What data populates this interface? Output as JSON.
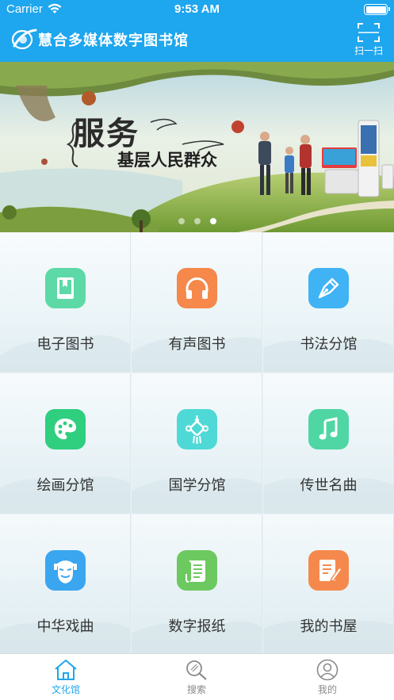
{
  "status_bar": {
    "carrier": "Carrier",
    "time": "9:53 AM"
  },
  "header": {
    "title": "慧合多媒体数字图书馆",
    "scan_label": "扫一扫"
  },
  "banner": {
    "headline": "服务",
    "subheadline": "基层人民群众",
    "dots": 3,
    "active_dot": 3
  },
  "grid": {
    "items": [
      {
        "label": "电子图书",
        "icon": "book-icon",
        "color": "#5cd9a6"
      },
      {
        "label": "有声图书",
        "icon": "headphones-icon",
        "color": "#f5884a"
      },
      {
        "label": "书法分馆",
        "icon": "pen-nib-icon",
        "color": "#3fb3f3"
      },
      {
        "label": "绘画分馆",
        "icon": "palette-icon",
        "color": "#2fcf7f"
      },
      {
        "label": "国学分馆",
        "icon": "chinese-knot-icon",
        "color": "#4fd9d6"
      },
      {
        "label": "传世名曲",
        "icon": "music-note-icon",
        "color": "#4fd6a4"
      },
      {
        "label": "中华戏曲",
        "icon": "opera-mask-icon",
        "color": "#3aa6ef"
      },
      {
        "label": "数字报纸",
        "icon": "newspaper-icon",
        "color": "#6cc960"
      },
      {
        "label": "我的书屋",
        "icon": "notebook-edit-icon",
        "color": "#f5894d"
      }
    ]
  },
  "tab_bar": {
    "tabs": [
      {
        "label": "文化馆",
        "icon": "home-icon",
        "active": true
      },
      {
        "label": "搜索",
        "icon": "search-icon",
        "active": false
      },
      {
        "label": "我的",
        "icon": "user-icon",
        "active": false
      }
    ]
  },
  "colors": {
    "primary": "#1ea6ee",
    "tab_inactive": "#8a8a8a"
  }
}
